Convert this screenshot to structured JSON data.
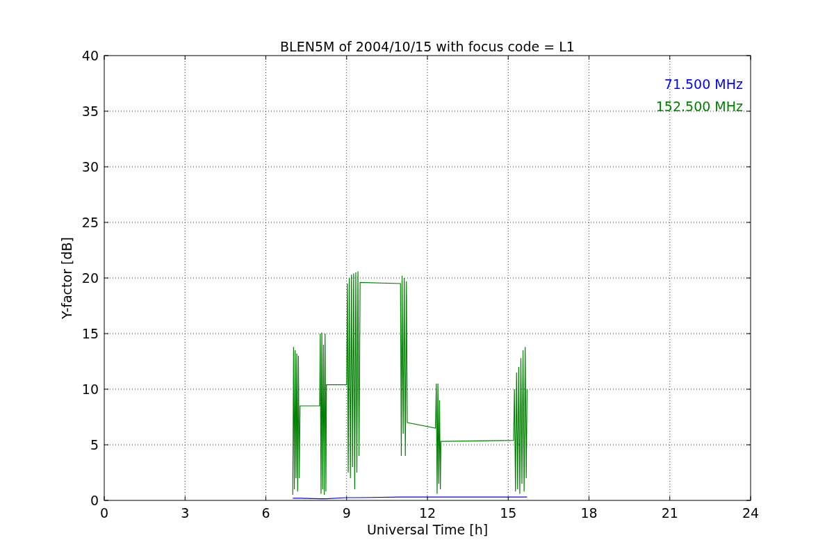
{
  "chart_data": {
    "type": "line",
    "grid": true,
    "title": "BLEN5M of 2004/10/15 with focus code = L1",
    "xlabel": "Universal Time [h]",
    "ylabel": "Y-factor [dB]",
    "xlim": [
      0,
      24
    ],
    "ylim": [
      0,
      40
    ],
    "xticks": [
      0,
      3,
      6,
      9,
      12,
      15,
      18,
      21,
      24
    ],
    "yticks": [
      0,
      5,
      10,
      15,
      20,
      25,
      30,
      35,
      40
    ],
    "x": [
      7.0,
      7.03,
      7.06,
      7.09,
      7.12,
      7.15,
      7.18,
      7.21,
      7.24,
      7.27,
      8.0,
      8.02,
      8.05,
      8.08,
      8.11,
      8.14,
      8.17,
      8.2,
      8.23,
      8.25,
      9.0,
      9.03,
      9.06,
      9.1,
      9.14,
      9.18,
      9.22,
      9.26,
      9.3,
      9.34,
      9.38,
      9.42,
      9.46,
      9.5,
      11.0,
      11.03,
      11.06,
      11.1,
      11.14,
      11.18,
      11.22,
      11.25,
      12.3,
      12.33,
      12.36,
      12.39,
      12.42,
      12.45,
      12.48,
      12.5,
      15.2,
      15.23,
      15.27,
      15.31,
      15.35,
      15.39,
      15.43,
      15.47,
      15.51,
      15.55,
      15.59,
      15.63,
      15.67,
      15.7
    ],
    "series": [
      {
        "name": "71.500 MHz",
        "color": "#0000ff",
        "values": [
          0.2,
          0.2,
          0.2,
          0.2,
          0.2,
          0.2,
          0.2,
          0.2,
          0.2,
          0.2,
          0.15,
          0.15,
          0.15,
          0.15,
          0.15,
          0.15,
          0.15,
          0.15,
          0.15,
          0.15,
          0.25,
          0.25,
          0.25,
          0.25,
          0.25,
          0.25,
          0.25,
          0.25,
          0.25,
          0.25,
          0.25,
          0.25,
          0.25,
          0.25,
          0.3,
          0.3,
          0.3,
          0.3,
          0.3,
          0.3,
          0.3,
          0.3,
          0.3,
          0.3,
          0.3,
          0.3,
          0.3,
          0.3,
          0.3,
          0.3,
          0.3,
          0.3,
          0.3,
          0.3,
          0.3,
          0.3,
          0.3,
          0.3,
          0.3,
          0.3,
          0.3,
          0.3,
          0.3,
          0.3
        ]
      },
      {
        "name": "152.500 MHz",
        "color": "#008000",
        "values": [
          0.5,
          13.8,
          1,
          13.5,
          2,
          13.2,
          0.8,
          13.0,
          2,
          8.5,
          8.5,
          15,
          0.6,
          15.1,
          1,
          14,
          0.5,
          15,
          0.8,
          10.4,
          10.4,
          19.5,
          2.5,
          20,
          2,
          20.3,
          3,
          20.4,
          1,
          20.5,
          2.5,
          20.6,
          4,
          19.6,
          19.5,
          4,
          20.2,
          6,
          20,
          4,
          19.7,
          7.0,
          6.5,
          10.5,
          0.6,
          10.5,
          1.5,
          9,
          1,
          5.3,
          5.4,
          10,
          0.8,
          11.5,
          1,
          12,
          0.6,
          12.8,
          1.5,
          13.5,
          0.8,
          13.8,
          2,
          10
        ]
      }
    ]
  }
}
